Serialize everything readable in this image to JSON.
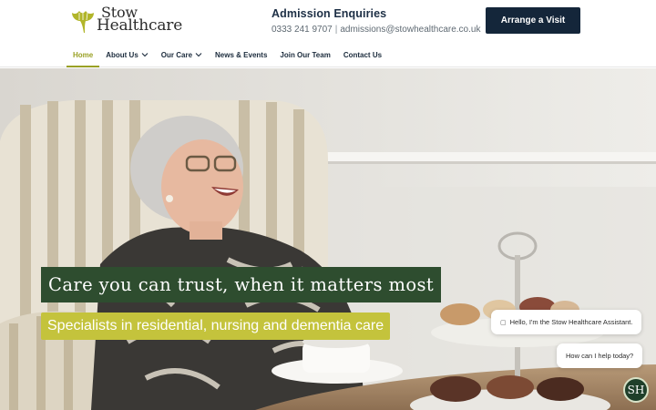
{
  "brand": {
    "name_line1": "Stow",
    "name_line2": "Healthcare",
    "accent": "#b1b52a",
    "dark": "#14263a"
  },
  "enquiries": {
    "title": "Admission Enquiries",
    "phone": "0333 241 9707",
    "separator": "|",
    "email": "admissions@stowhealthcare.co.uk"
  },
  "cta": {
    "label": "Arrange a Visit"
  },
  "nav": {
    "items": [
      {
        "label": "Home",
        "active": true
      },
      {
        "label": "About Us",
        "dropdown": true
      },
      {
        "label": "Our Care",
        "dropdown": true
      },
      {
        "label": "News & Events"
      },
      {
        "label": "Join Our Team"
      },
      {
        "label": "Contact Us"
      }
    ]
  },
  "hero": {
    "headline": "Care you can trust, when it matters most",
    "subheadline": "Specialists in residential, nursing and dementia care"
  },
  "chat": {
    "greeting": "Hello, I'm the Stow Healthcare Assistant.",
    "prompt": "How can I help today?",
    "avatar_initials": "SH"
  }
}
